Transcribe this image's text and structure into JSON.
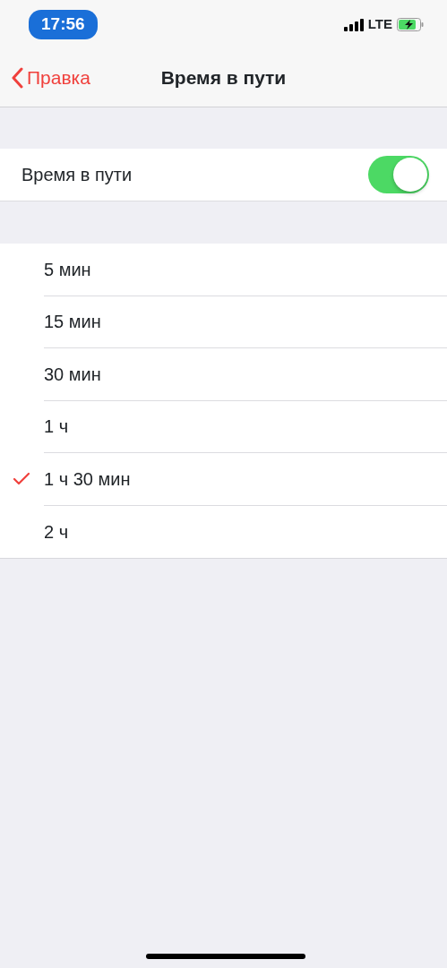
{
  "status_bar": {
    "time": "17:56",
    "network": "LTE"
  },
  "nav": {
    "back": "Правка",
    "title": "Время в пути"
  },
  "toggle": {
    "label": "Время в пути",
    "on": true
  },
  "options": [
    {
      "label": "5 мин",
      "selected": false
    },
    {
      "label": "15 мин",
      "selected": false
    },
    {
      "label": "30 мин",
      "selected": false
    },
    {
      "label": "1 ч",
      "selected": false
    },
    {
      "label": "1 ч 30 мин",
      "selected": true
    },
    {
      "label": "2 ч",
      "selected": false
    }
  ]
}
